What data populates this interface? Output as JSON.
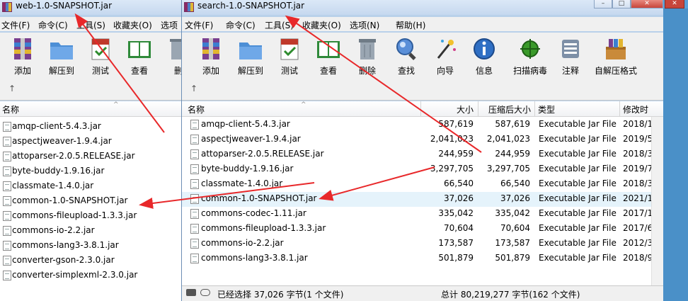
{
  "window_left": {
    "title": "web-1.0-SNAPSHOT.jar",
    "menu": [
      "文件(F)",
      "命令(C)",
      "工具(S)",
      "收藏夹(O)",
      "选项"
    ],
    "toolbar": [
      {
        "label": "添加",
        "icon": "add-archive-icon"
      },
      {
        "label": "解压到",
        "icon": "extract-folder-icon"
      },
      {
        "label": "测试",
        "icon": "test-icon"
      },
      {
        "label": "查看",
        "icon": "view-book-icon"
      },
      {
        "label": "删",
        "icon": "delete-icon"
      }
    ],
    "column_name": "名称",
    "files": [
      "amqp-client-5.4.3.jar",
      "aspectjweaver-1.9.4.jar",
      "attoparser-2.0.5.RELEASE.jar",
      "byte-buddy-1.9.16.jar",
      "classmate-1.4.0.jar",
      "common-1.0-SNAPSHOT.jar",
      "commons-fileupload-1.3.3.jar",
      "commons-io-2.2.jar",
      "commons-lang3-3.8.1.jar",
      "converter-gson-2.3.0.jar",
      "converter-simplexml-2.3.0.jar"
    ]
  },
  "window_right": {
    "title": "search-1.0-SNAPSHOT.jar",
    "menu": [
      "文件(F)",
      "命令(C)",
      "工具(S)",
      "收藏夹(O)",
      "选项(N)",
      "帮助(H)"
    ],
    "toolbar": [
      {
        "label": "添加",
        "icon": "add-archive-icon"
      },
      {
        "label": "解压到",
        "icon": "extract-folder-icon"
      },
      {
        "label": "测试",
        "icon": "test-icon"
      },
      {
        "label": "查看",
        "icon": "view-book-icon"
      },
      {
        "label": "删除",
        "icon": "delete-icon"
      },
      {
        "label": "查找",
        "icon": "find-icon"
      },
      {
        "label": "向导",
        "icon": "wizard-icon"
      },
      {
        "label": "信息",
        "icon": "info-icon"
      },
      {
        "label": "扫描病毒",
        "icon": "virus-scan-icon"
      },
      {
        "label": "注释",
        "icon": "comment-icon"
      },
      {
        "label": "自解压格式",
        "icon": "sfx-icon"
      }
    ],
    "columns": {
      "name": "名称",
      "size": "大小",
      "packed": "压缩后大小",
      "type": "类型",
      "modified": "修改时"
    },
    "rows": [
      {
        "name": "amqp-client-5.4.3.jar",
        "size": "587,619",
        "packed": "587,619",
        "type": "Executable Jar File",
        "modified": "2018/1"
      },
      {
        "name": "aspectjweaver-1.9.4.jar",
        "size": "2,041,023",
        "packed": "2,041,023",
        "type": "Executable Jar File",
        "modified": "2019/5"
      },
      {
        "name": "attoparser-2.0.5.RELEASE.jar",
        "size": "244,959",
        "packed": "244,959",
        "type": "Executable Jar File",
        "modified": "2018/3"
      },
      {
        "name": "byte-buddy-1.9.16.jar",
        "size": "3,297,705",
        "packed": "3,297,705",
        "type": "Executable Jar File",
        "modified": "2019/7"
      },
      {
        "name": "classmate-1.4.0.jar",
        "size": "66,540",
        "packed": "66,540",
        "type": "Executable Jar File",
        "modified": "2018/3"
      },
      {
        "name": "common-1.0-SNAPSHOT.jar",
        "size": "37,026",
        "packed": "37,026",
        "type": "Executable Jar File",
        "modified": "2021/1"
      },
      {
        "name": "commons-codec-1.11.jar",
        "size": "335,042",
        "packed": "335,042",
        "type": "Executable Jar File",
        "modified": "2017/1"
      },
      {
        "name": "commons-fileupload-1.3.3.jar",
        "size": "70,604",
        "packed": "70,604",
        "type": "Executable Jar File",
        "modified": "2017/6"
      },
      {
        "name": "commons-io-2.2.jar",
        "size": "173,587",
        "packed": "173,587",
        "type": "Executable Jar File",
        "modified": "2012/3"
      },
      {
        "name": "commons-lang3-3.8.1.jar",
        "size": "501,879",
        "packed": "501,879",
        "type": "Executable Jar File",
        "modified": "2018/9"
      }
    ],
    "status_left": "已经选择 37,026 字节(1 个文件)",
    "status_right": "总计 80,219,277 字节(162 个文件)"
  },
  "colors": {
    "arrow": "#e8282a",
    "selected_row": "#e5f3fb",
    "title_bar": "#c5d8ef"
  }
}
